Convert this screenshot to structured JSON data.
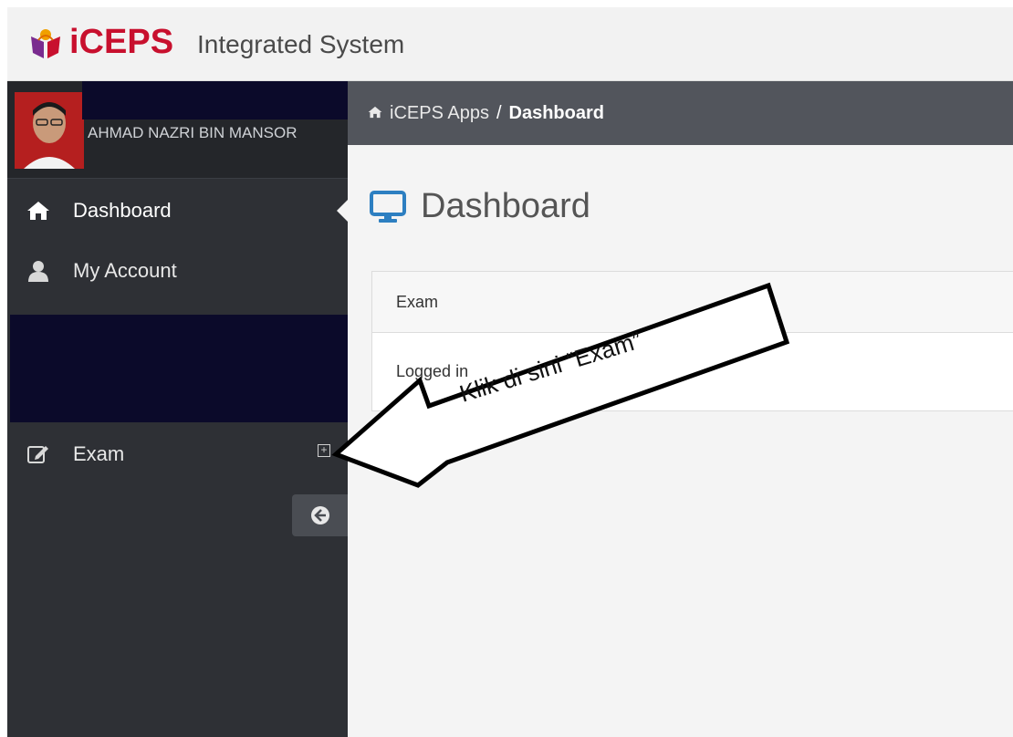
{
  "header": {
    "logo_text": "iCEPS",
    "system_name": "Integrated System",
    "brand_color": "#c8102e"
  },
  "sidebar": {
    "user_name": "AHMAD NAZRI BIN MANSOR",
    "items": [
      {
        "label": "Dashboard",
        "icon": "home-icon",
        "active": true
      },
      {
        "label": "My Account",
        "icon": "user-icon",
        "active": false
      },
      {
        "label": "Exam",
        "icon": "edit-icon",
        "active": false
      }
    ],
    "expand_icon": "plus-square-icon",
    "collapse_icon": "arrow-circle-left-icon"
  },
  "breadcrumb": {
    "root": "iCEPS Apps",
    "separator": "/",
    "current": "Dashboard"
  },
  "main": {
    "page_title": "Dashboard",
    "panel": {
      "header": "Exam",
      "body": "Logged in"
    }
  },
  "annotation": {
    "text": "Klik di sini “Exam”"
  }
}
